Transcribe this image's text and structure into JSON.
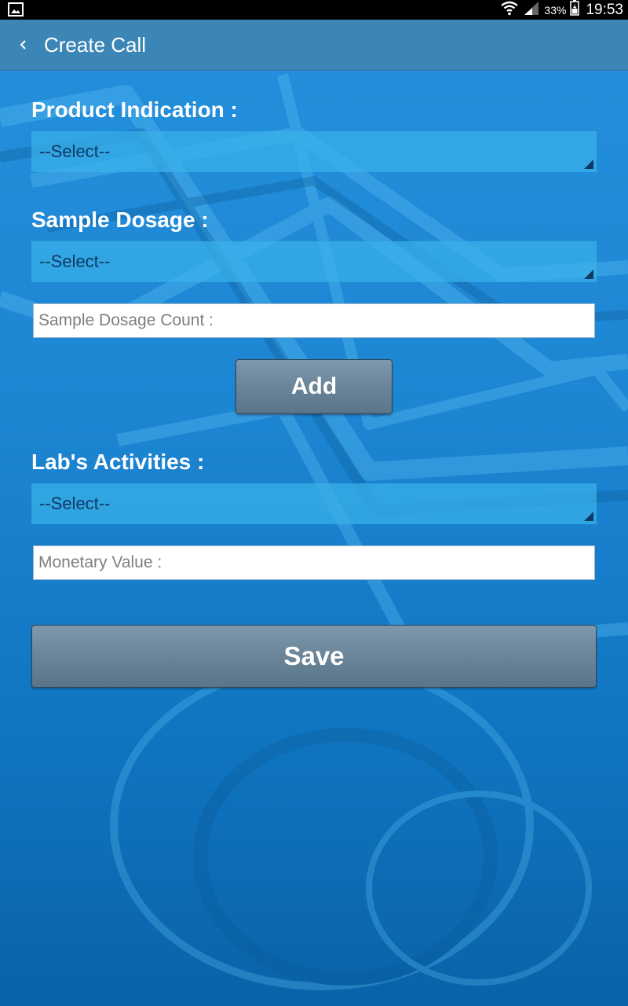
{
  "status_bar": {
    "battery_percent": "33%",
    "time": "19:53",
    "icons": [
      "gallery-icon",
      "wifi-icon",
      "signal-icon",
      "battery-icon"
    ]
  },
  "action_bar": {
    "title": "Create Call",
    "back_icon": "chevron-left-icon"
  },
  "form": {
    "product_indication": {
      "label": "Product Indication :",
      "selected": "--Select--"
    },
    "sample_dosage": {
      "label": "Sample Dosage :",
      "selected": "--Select--"
    },
    "sample_dosage_count": {
      "placeholder": "Sample Dosage Count :",
      "value": ""
    },
    "add_button": "Add",
    "labs_activities": {
      "label": "Lab's Activities :",
      "selected": "--Select--"
    },
    "monetary_value": {
      "placeholder": "Monetary Value :",
      "value": ""
    },
    "save_button": "Save"
  },
  "colors": {
    "background": "#1d86d3",
    "action_bar": "#3b86b6",
    "dropdown": "#3ab2ea",
    "button": "#6a8599",
    "text": "#ffffff"
  }
}
